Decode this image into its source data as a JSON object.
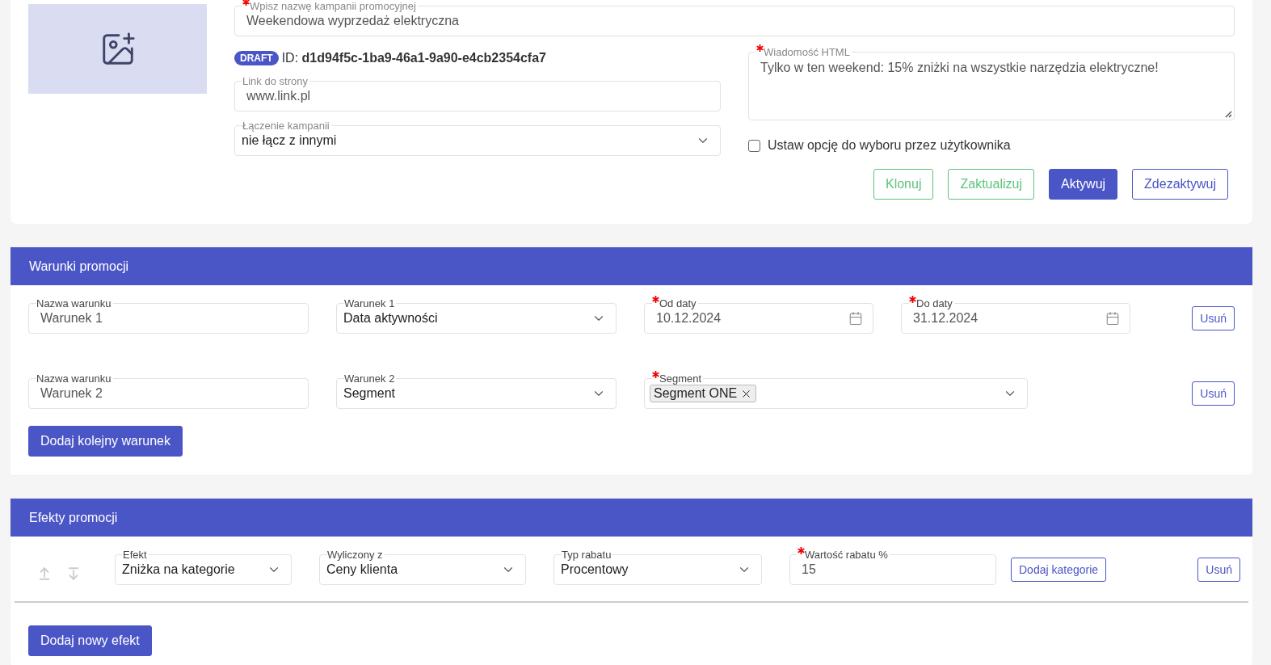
{
  "campaign": {
    "name_field": {
      "label": "Wpisz nazwę kampanii promocyjnej",
      "required": true,
      "value": "Weekendowa wyprzedaż elektryczna"
    },
    "status_badge": "DRAFT",
    "id_text": "ID: **d1d94f5c-1ba9-46a1-9a90-e4cb2354cfa7**",
    "link_field": {
      "label": "Link do strony",
      "value": "www.link.pl"
    },
    "combine_select": {
      "label": "Łączenie kampanii",
      "value": "nie łącz z innymi"
    },
    "html_message": {
      "label": "Wiadomość HTML",
      "required": true,
      "value": "Tylko w ten weekend: 15% zniżki na wszystkie narzędzia elektryczne!"
    },
    "user_option": {
      "label": "Ustaw opcję do wyboru przez użytkownika",
      "checked": false
    },
    "actions": [
      "Klonuj",
      "Zaktualizuj",
      "Aktywuj",
      "Zdezaktywuj"
    ]
  },
  "conditions": {
    "title": "Warunki promocji",
    "rows": [
      {
        "name": {
          "label": "Nazwa warunku",
          "value": "Warunek 1"
        },
        "type": {
          "label": "Warunek 1",
          "value": "Data aktywności"
        },
        "params": [
          {
            "kind": "date",
            "label": "Od daty",
            "required": true,
            "value": "10.12.2024"
          },
          {
            "kind": "date",
            "label": "Do daty",
            "required": true,
            "value": "31.12.2024"
          }
        ],
        "remove": "Usuń"
      },
      {
        "name": {
          "label": "Nazwa warunku",
          "value": "Warunek 2"
        },
        "type": {
          "label": "Warunek 2",
          "value": "Segment"
        },
        "params": [
          {
            "kind": "multiselect",
            "label": "Segment",
            "required": true,
            "tags": [
              "Segment ONE"
            ]
          }
        ],
        "remove": "Usuń"
      }
    ],
    "add_button": "Dodaj kolejny warunek"
  },
  "effects": {
    "title": "Efekty promocji",
    "rows": [
      {
        "move": [
          {
            "kind": "up",
            "disabled": true
          },
          {
            "kind": "down",
            "disabled": true
          }
        ],
        "fields": [
          {
            "kind": "select",
            "label": "Efekt",
            "value": "Zniżka na kategorie"
          },
          {
            "kind": "select",
            "label": "Wyliczony z",
            "value": "Ceny klienta"
          },
          {
            "kind": "select",
            "label": "Typ rabatu",
            "value": "Procentowy"
          },
          {
            "kind": "text",
            "label": "Wartość rabatu %",
            "required": true,
            "value": "15"
          }
        ],
        "extra_button": "Dodaj kategorie",
        "remove": "Usuń"
      }
    ],
    "add_button": "Dodaj nowy efekt"
  }
}
